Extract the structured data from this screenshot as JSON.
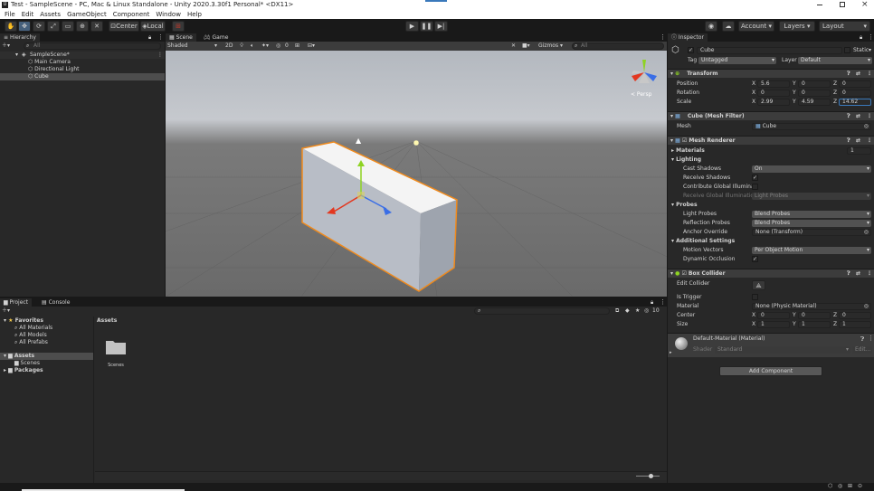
{
  "window": {
    "title": "Test - SampleScene - PC, Mac & Linux Standalone - Unity 2020.3.30f1 Personal* <DX11>",
    "logo": "U"
  },
  "menu": [
    "File",
    "Edit",
    "Assets",
    "GameObject",
    "Component",
    "Window",
    "Help"
  ],
  "toolbar": {
    "center_label": "Center",
    "local_label": "Local",
    "account_label": "Account",
    "layers_label": "Layers",
    "layout_label": "Layout"
  },
  "hierarchy": {
    "tab": "Hierarchy",
    "search_placeholder": "All",
    "scene": "SampleScene*",
    "items": [
      "Main Camera",
      "Directional Light",
      "Cube"
    ]
  },
  "scene_view": {
    "tabs": [
      "Scene",
      "Game"
    ],
    "shading": "Shaded",
    "mode_2d": "2D",
    "gizmos": "Gizmos",
    "search_placeholder": "All",
    "hidden_count": "0",
    "persp": "< Persp"
  },
  "project": {
    "tabs": [
      "Project",
      "Console"
    ],
    "hidden_count": "10",
    "favorites_label": "Favorites",
    "favorites": [
      "All Materials",
      "All Models",
      "All Prefabs"
    ],
    "assets_label": "Assets",
    "assets_children": [
      "Scenes"
    ],
    "packages_label": "Packages",
    "breadcrumb": "Assets",
    "folder_name": "Scenes"
  },
  "inspector": {
    "tab": "Inspector",
    "object_name": "Cube",
    "static_label": "Static",
    "tag_label": "Tag",
    "tag_value": "Untagged",
    "layer_label": "Layer",
    "layer_value": "Default",
    "transform": {
      "title": "Transform",
      "position": {
        "label": "Position",
        "x": "5.6",
        "y": "0",
        "z": "0"
      },
      "rotation": {
        "label": "Rotation",
        "x": "0",
        "y": "0",
        "z": "0"
      },
      "scale": {
        "label": "Scale",
        "x": "2.99",
        "y": "4.59",
        "z": "14.62"
      }
    },
    "mesh_filter": {
      "title": "Cube (Mesh Filter)",
      "mesh_label": "Mesh",
      "mesh_value": "Cube"
    },
    "mesh_renderer": {
      "title": "Mesh Renderer",
      "materials_label": "Materials",
      "materials_count": "1",
      "lighting_label": "Lighting",
      "cast_shadows_label": "Cast Shadows",
      "cast_shadows_value": "On",
      "receive_shadows_label": "Receive Shadows",
      "contribute_gi_label": "Contribute Global Illuminat",
      "receive_gi_label": "Receive Global Illuminatio",
      "receive_gi_value": "Light Probes",
      "probes_label": "Probes",
      "light_probes_label": "Light Probes",
      "light_probes_value": "Blend Probes",
      "reflection_probes_label": "Reflection Probes",
      "reflection_probes_value": "Blend Probes",
      "anchor_override_label": "Anchor Override",
      "anchor_override_value": "None (Transform)",
      "additional_label": "Additional Settings",
      "motion_vectors_label": "Motion Vectors",
      "motion_vectors_value": "Per Object Motion",
      "dynamic_occlusion_label": "Dynamic Occlusion"
    },
    "box_collider": {
      "title": "Box Collider",
      "edit_collider_label": "Edit Collider",
      "is_trigger_label": "Is Trigger",
      "material_label": "Material",
      "material_value": "None (Physic Material)",
      "center": {
        "label": "Center",
        "x": "0",
        "y": "0",
        "z": "0"
      },
      "size": {
        "label": "Size",
        "x": "1",
        "y": "1",
        "z": "1"
      }
    },
    "material": {
      "name": "Default-Material (Material)",
      "shader_label": "Shader",
      "shader_value": "Standard",
      "edit_label": "Edit..."
    },
    "add_component": "Add Component",
    "axis": {
      "x": "X",
      "y": "Y",
      "z": "Z"
    }
  },
  "colors": {
    "accent": "#3a79bb",
    "selection_orange": "#f08a1c",
    "x_axis": "#e3371f",
    "y_axis": "#8ed322",
    "z_axis": "#3a6ee6"
  }
}
